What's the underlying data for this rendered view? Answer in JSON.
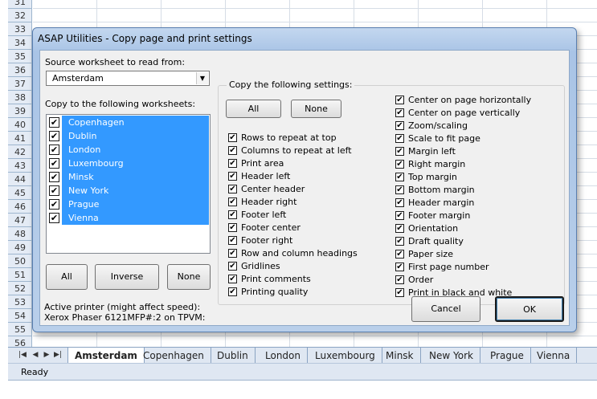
{
  "sheet": {
    "rows": [
      "31",
      "32",
      "33",
      "34",
      "35",
      "36",
      "37",
      "38",
      "39",
      "40",
      "41",
      "42",
      "43",
      "44",
      "45",
      "46",
      "47",
      "48",
      "49",
      "50",
      "51",
      "52",
      "53",
      "54",
      "55",
      "56"
    ],
    "tabs": [
      "Amsterdam",
      "Copenhagen",
      "Dublin",
      "London",
      "Luxembourg",
      "Minsk",
      "New York",
      "Prague",
      "Vienna"
    ],
    "status": "Ready"
  },
  "dialog": {
    "title": "ASAP Utilities - Copy page and print settings",
    "source_label": "Source worksheet to read from:",
    "source_value": "Amsterdam",
    "copy_to_label": "Copy to the following worksheets:",
    "worksheets": [
      "Copenhagen",
      "Dublin",
      "London",
      "Luxembourg",
      "Minsk",
      "New York",
      "Prague",
      "Vienna"
    ],
    "btn_all": "All",
    "btn_inverse": "Inverse",
    "btn_none": "None",
    "settings_label": "Copy the following settings:",
    "settings_all": "All",
    "settings_none": "None",
    "settings_left": [
      "Rows to repeat at top",
      "Columns to repeat at left",
      "Print area",
      "Header left",
      "Center header",
      "Header right",
      "Footer left",
      "Footer center",
      "Footer right",
      "Row and column headings",
      "Gridlines",
      "Print comments",
      "Printing quality"
    ],
    "settings_right": [
      "Center on page horizontally",
      "Center on page vertically",
      "Zoom/scaling",
      "Scale to fit page",
      "Margin left",
      "Right margin",
      "Top margin",
      "Bottom margin",
      "Header margin",
      "Footer margin",
      "Orientation",
      "Draft quality",
      "Paper size",
      "First page number",
      "Order",
      "Print in black and white"
    ],
    "printer_label": "Active printer (might affect speed):",
    "printer_name": "Xerox Phaser 6121MFP#:2 on TPVM:",
    "cancel": "Cancel",
    "ok": "OK",
    "check_mark": "✔"
  }
}
